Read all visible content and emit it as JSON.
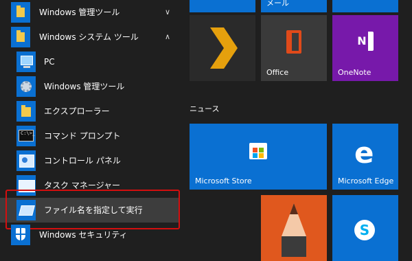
{
  "applist": {
    "items": [
      {
        "label": "Windows 管理ツール",
        "chevron": "∨"
      },
      {
        "label": "Windows システム ツール",
        "chevron": "∧"
      },
      {
        "label": "PC"
      },
      {
        "label": "Windows 管理ツール"
      },
      {
        "label": "エクスプローラー"
      },
      {
        "label": "コマンド プロンプト"
      },
      {
        "label": "コントロール パネル"
      },
      {
        "label": "タスク マネージャー"
      },
      {
        "label": "ファイル名を指定して実行"
      },
      {
        "label": "Windows セキュリティ"
      }
    ]
  },
  "tiles": {
    "top_partial_label": "メール",
    "section_heading": "ニュース",
    "office_label": "Office",
    "onenote_label": "OneNote",
    "store_label": "Microsoft Store",
    "edge_label": "Microsoft Edge",
    "edge_glyph": "e",
    "skype_glyph": "S",
    "cmd_glyph": "C:\\>_"
  },
  "colors": {
    "accent": "#0a70d2",
    "highlight_border": "#d40f0f",
    "background": "#1f1f1f",
    "onenote": "#7719aa",
    "office_tile": "#3a3a3a",
    "plex_tile": "#2a2a2a",
    "sketch_tile": "#e0581e"
  },
  "icons": {
    "group_folder": "folder-icon",
    "pc": "monitor-icon",
    "admin_tools": "gear-icon",
    "explorer": "folder-icon",
    "cmd": "command-prompt-icon",
    "control_panel": "control-panel-icon",
    "task_manager": "task-manager-icon",
    "run": "run-icon",
    "security": "shield-icon"
  }
}
